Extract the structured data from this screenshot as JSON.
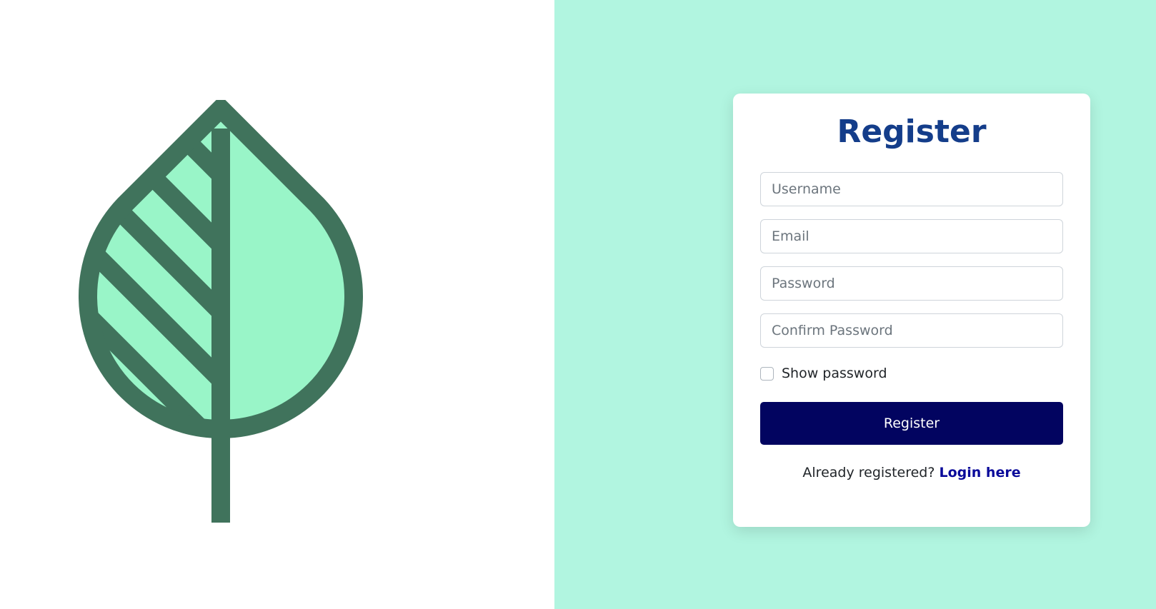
{
  "colors": {
    "left_background": "#ffffff",
    "right_background": "#b1f5e0",
    "leaf_outline": "#40735c",
    "leaf_fill": "#99f5c8",
    "title_color": "#143d8a",
    "button_background": "#020460",
    "link_color": "#0a0a9a"
  },
  "logo": {
    "icon": "leaf-icon"
  },
  "form": {
    "title": "Register",
    "username_placeholder": "Username",
    "email_placeholder": "Email",
    "password_placeholder": "Password",
    "confirm_password_placeholder": "Confirm Password",
    "show_password_label": "Show password",
    "show_password_checked": false,
    "submit_label": "Register",
    "footer_text": "Already registered?",
    "login_link_label": "Login here"
  }
}
